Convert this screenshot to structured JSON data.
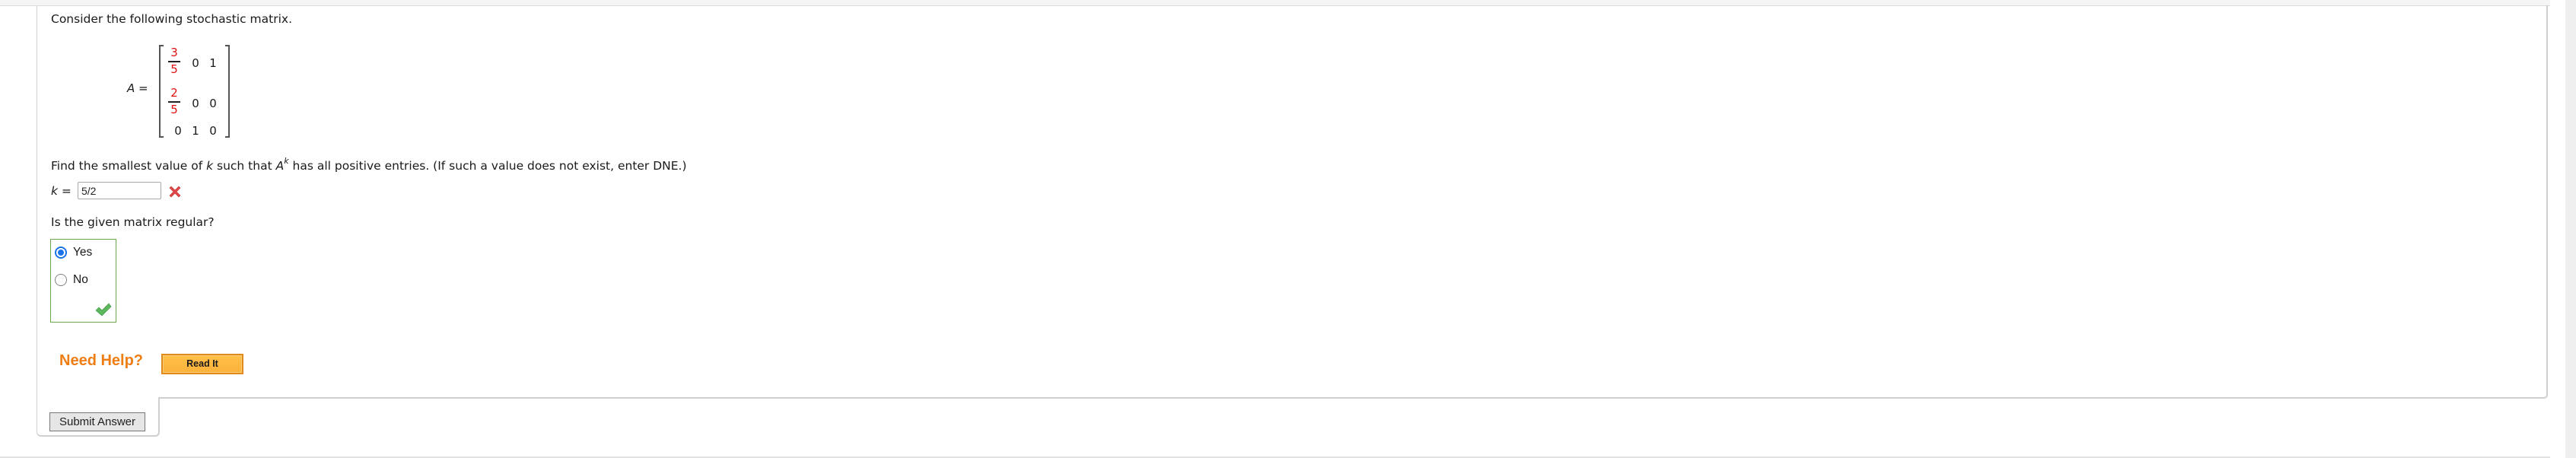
{
  "question": {
    "intro": "Consider the following stochastic matrix.",
    "matrix": {
      "name": "A",
      "equals": "=",
      "rows": [
        [
          {
            "type": "fraction",
            "num": "3",
            "den": "5"
          },
          {
            "type": "number",
            "value": "0"
          },
          {
            "type": "number",
            "value": "1"
          }
        ],
        [
          {
            "type": "fraction",
            "num": "2",
            "den": "5"
          },
          {
            "type": "number",
            "value": "0"
          },
          {
            "type": "number",
            "value": "0"
          }
        ],
        [
          {
            "type": "number",
            "value": "0"
          },
          {
            "type": "number",
            "value": "1"
          },
          {
            "type": "number",
            "value": "0"
          }
        ]
      ],
      "fraction_color": "#e01010"
    },
    "part1": {
      "prefix": "Find the smallest value of ",
      "var_k": "k",
      "middle": " such that ",
      "var_A": "A",
      "sup": "k",
      "suffix": " has all positive entries. (If such a value does not exist, enter DNE.)",
      "answer_label_var": "k",
      "answer_label_eq": " = ",
      "answer_value": "5/2",
      "status": "incorrect",
      "status_icon": "x-mark-icon"
    },
    "part2": {
      "prompt": "Is the given matrix regular?",
      "options": [
        {
          "label": "Yes",
          "selected": true
        },
        {
          "label": "No",
          "selected": false
        }
      ],
      "status": "correct",
      "status_icon": "check-mark-icon"
    }
  },
  "help": {
    "label": "Need Help?",
    "read_it_button": "Read It"
  },
  "actions": {
    "submit_label": "Submit Answer"
  },
  "colors": {
    "help_orange": "#ee7d14",
    "correct_green": "#6aa84f",
    "incorrect_red": "#e04848",
    "radio_blue": "#1a73e8"
  }
}
